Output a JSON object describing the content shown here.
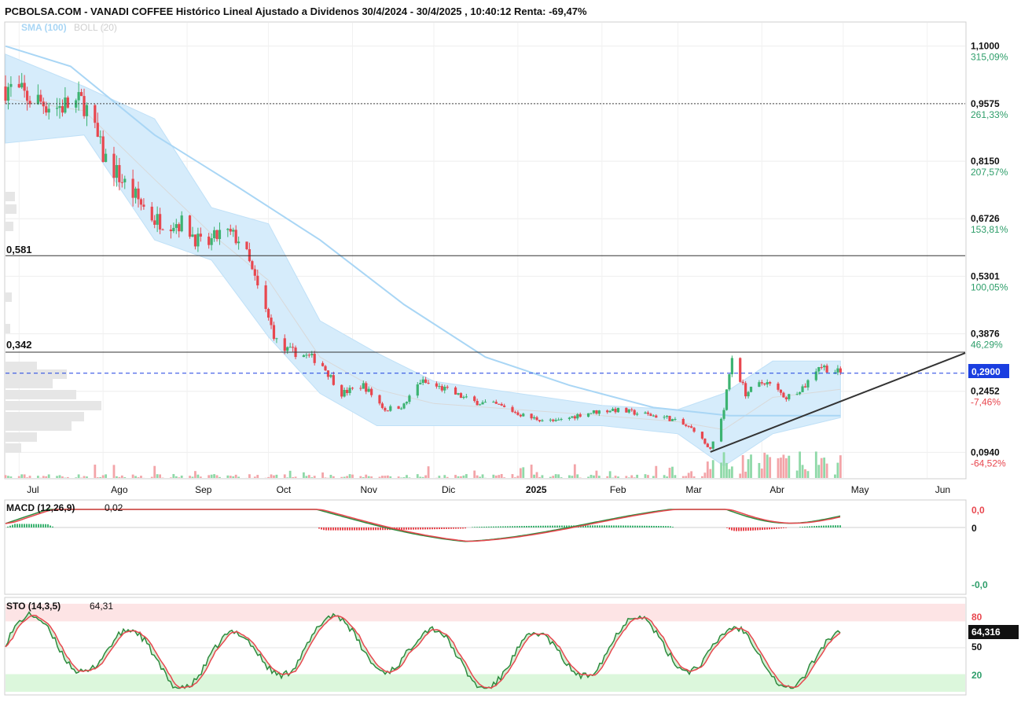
{
  "header": {
    "title": "PCBOLSA.COM - VANADI COFFEE Histórico Lineal Ajustado a Dividenos 30/4/2024 - 30/4/2025 , 10:40:12 Renta: -69,47%",
    "legend_sma": "SMA (100)",
    "legend_boll": "BOLL (20)"
  },
  "price_axis": {
    "ticks": [
      {
        "price": "1,1000",
        "pct": "315,09%",
        "pct_sign": "pos",
        "v": 1.1
      },
      {
        "price": "0,9575",
        "pct": "261,33%",
        "pct_sign": "pos",
        "v": 0.9575
      },
      {
        "price": "0,8150",
        "pct": "207,57%",
        "pct_sign": "pos",
        "v": 0.815
      },
      {
        "price": "0,6726",
        "pct": "153,81%",
        "pct_sign": "pos",
        "v": 0.6726
      },
      {
        "price": "0,5301",
        "pct": "100,05%",
        "pct_sign": "pos",
        "v": 0.5301
      },
      {
        "price": "0,3876",
        "pct": "46,29%",
        "pct_sign": "pos",
        "v": 0.3876
      },
      {
        "price": "0,2452",
        "pct": "-7,46%",
        "pct_sign": "neg",
        "v": 0.2452
      },
      {
        "price": "0,0940",
        "pct": "-64,52%",
        "pct_sign": "neg",
        "v": 0.094
      }
    ],
    "last_price": "0,2900",
    "last_value": 0.29,
    "dotted_level": 0.9575
  },
  "levels": [
    {
      "label": "0,581",
      "value": 0.581
    },
    {
      "label": "0,342",
      "value": 0.342
    }
  ],
  "x_axis": {
    "months": [
      {
        "label": "Jul",
        "bold": false
      },
      {
        "label": "Ago",
        "bold": false
      },
      {
        "label": "Sep",
        "bold": false
      },
      {
        "label": "Oct",
        "bold": false
      },
      {
        "label": "Nov",
        "bold": false
      },
      {
        "label": "Dic",
        "bold": false
      },
      {
        "label": "2025",
        "bold": true
      },
      {
        "label": "Feb",
        "bold": false
      },
      {
        "label": "Mar",
        "bold": false
      },
      {
        "label": "Abr",
        "bold": false
      },
      {
        "label": "May",
        "bold": false
      },
      {
        "label": "Jun",
        "bold": false
      }
    ]
  },
  "macd_panel": {
    "label": "MACD (12,26,9)",
    "value": "0,02",
    "axis_top": "0,0",
    "axis_zero": "0",
    "axis_bottom": "-0,0"
  },
  "sto_panel": {
    "label": "STO (14,3,5)",
    "value": "64,31",
    "level_80": "80",
    "level_50": "50",
    "level_20": "20",
    "current": "64,316",
    "current_value": 64.316
  },
  "colors": {
    "up": "#3cb371",
    "down": "#e8474f",
    "boll_fill": "#d6ecfb",
    "sma": "#a9d6f5",
    "pos_pct": "#2e9e6a",
    "neg_pct": "#e8474f"
  },
  "chart_data": [
    {
      "type": "candlestick",
      "title": "PCBOLSA.COM - VANADI COFFEE Histórico Lineal Ajustado a Dividenos 30/4/2024 - 30/4/2025 , 10:40:12 Renta: -69,47%",
      "x_range": [
        "2024-06-26",
        "2025-06-15"
      ],
      "ylim": [
        0.06,
        1.15
      ],
      "close_series": [
        {
          "date": "2024-06-26",
          "close": 1.0
        },
        {
          "date": "2024-07-05",
          "close": 0.97
        },
        {
          "date": "2024-07-15",
          "close": 0.95
        },
        {
          "date": "2024-07-25",
          "close": 0.96
        },
        {
          "date": "2024-08-01",
          "close": 0.83
        },
        {
          "date": "2024-08-10",
          "close": 0.75
        },
        {
          "date": "2024-08-20",
          "close": 0.67
        },
        {
          "date": "2024-08-31",
          "close": 0.66
        },
        {
          "date": "2024-09-07",
          "close": 0.6
        },
        {
          "date": "2024-09-14",
          "close": 0.64
        },
        {
          "date": "2024-09-21",
          "close": 0.62
        },
        {
          "date": "2024-09-28",
          "close": 0.48
        },
        {
          "date": "2024-10-05",
          "close": 0.35
        },
        {
          "date": "2024-10-12",
          "close": 0.34
        },
        {
          "date": "2024-10-20",
          "close": 0.32
        },
        {
          "date": "2024-10-28",
          "close": 0.24
        },
        {
          "date": "2024-11-05",
          "close": 0.26
        },
        {
          "date": "2024-11-13",
          "close": 0.2
        },
        {
          "date": "2024-11-20",
          "close": 0.21
        },
        {
          "date": "2024-11-26",
          "close": 0.27
        },
        {
          "date": "2024-12-05",
          "close": 0.25
        },
        {
          "date": "2024-12-15",
          "close": 0.22
        },
        {
          "date": "2024-12-25",
          "close": 0.21
        },
        {
          "date": "2025-01-05",
          "close": 0.18
        },
        {
          "date": "2025-01-15",
          "close": 0.17
        },
        {
          "date": "2025-01-25",
          "close": 0.19
        },
        {
          "date": "2025-02-05",
          "close": 0.2
        },
        {
          "date": "2025-02-15",
          "close": 0.19
        },
        {
          "date": "2025-02-25",
          "close": 0.18
        },
        {
          "date": "2025-03-07",
          "close": 0.15
        },
        {
          "date": "2025-03-13",
          "close": 0.1
        },
        {
          "date": "2025-03-18",
          "close": 0.2
        },
        {
          "date": "2025-03-21",
          "close": 0.33
        },
        {
          "date": "2025-03-26",
          "close": 0.24
        },
        {
          "date": "2025-04-02",
          "close": 0.27
        },
        {
          "date": "2025-04-10",
          "close": 0.23
        },
        {
          "date": "2025-04-17",
          "close": 0.26
        },
        {
          "date": "2025-04-22",
          "close": 0.31
        },
        {
          "date": "2025-04-30",
          "close": 0.29
        }
      ],
      "sma_100": [
        {
          "date": "2024-06-26",
          "value": 1.1
        },
        {
          "date": "2024-07-20",
          "value": 1.05
        },
        {
          "date": "2024-08-20",
          "value": 0.88
        },
        {
          "date": "2024-09-20",
          "value": 0.75
        },
        {
          "date": "2024-10-20",
          "value": 0.62
        },
        {
          "date": "2024-11-20",
          "value": 0.46
        },
        {
          "date": "2024-12-20",
          "value": 0.33
        },
        {
          "date": "2025-01-20",
          "value": 0.26
        },
        {
          "date": "2025-02-20",
          "value": 0.205
        },
        {
          "date": "2025-03-20",
          "value": 0.185
        },
        {
          "date": "2025-04-30",
          "value": 0.185
        }
      ],
      "boll_20": [
        {
          "date": "2024-06-26",
          "upper": 1.08,
          "lower": 0.86
        },
        {
          "date": "2024-07-25",
          "upper": 1.0,
          "lower": 0.88
        },
        {
          "date": "2024-08-20",
          "upper": 0.92,
          "lower": 0.62
        },
        {
          "date": "2024-09-10",
          "upper": 0.7,
          "lower": 0.57
        },
        {
          "date": "2024-10-01",
          "upper": 0.66,
          "lower": 0.38
        },
        {
          "date": "2024-10-20",
          "upper": 0.42,
          "lower": 0.24
        },
        {
          "date": "2024-11-10",
          "upper": 0.34,
          "lower": 0.16
        },
        {
          "date": "2024-12-01",
          "upper": 0.27,
          "lower": 0.16
        },
        {
          "date": "2025-01-01",
          "upper": 0.24,
          "lower": 0.16
        },
        {
          "date": "2025-02-01",
          "upper": 0.21,
          "lower": 0.16
        },
        {
          "date": "2025-03-01",
          "upper": 0.2,
          "lower": 0.14
        },
        {
          "date": "2025-03-18",
          "upper": 0.24,
          "lower": 0.06
        },
        {
          "date": "2025-04-05",
          "upper": 0.32,
          "lower": 0.14
        },
        {
          "date": "2025-04-30",
          "upper": 0.32,
          "lower": 0.18
        }
      ],
      "trendline": {
        "start": {
          "date": "2025-03-13",
          "value": 0.095
        },
        "end": {
          "date": "2025-06-15",
          "value": 0.34
        }
      }
    },
    {
      "type": "histogram",
      "name": "MACD (12,26,9)",
      "value": "0,02"
    },
    {
      "type": "line",
      "name": "STO (14,3,5)",
      "value": "64,31",
      "levels": [
        80,
        50,
        20
      ],
      "current": 64.316
    }
  ]
}
